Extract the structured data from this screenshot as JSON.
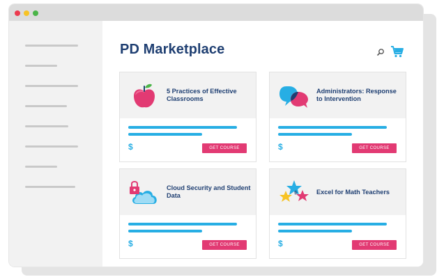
{
  "window": {
    "controls": [
      "close",
      "minimize",
      "maximize"
    ]
  },
  "sidebar": {
    "items": [
      {
        "placeholder": "line"
      },
      {
        "placeholder": "line"
      },
      {
        "placeholder": "line"
      },
      {
        "placeholder": "line"
      },
      {
        "placeholder": "line"
      },
      {
        "placeholder": "line"
      },
      {
        "placeholder": "line"
      },
      {
        "placeholder": "line"
      }
    ]
  },
  "header": {
    "title": "PD Marketplace",
    "search_icon": "search-icon",
    "cart_icon": "cart-icon"
  },
  "courses": [
    {
      "title": "5 Practices of Effective Classrooms",
      "icon": "apple-icon",
      "price": "$",
      "button": "GET COURSE"
    },
    {
      "title": "Administrators: Response to Intervention",
      "icon": "speech-bubbles-icon",
      "price": "$",
      "button": "GET COURSE"
    },
    {
      "title": "Cloud Security and Student Data",
      "icon": "cloud-lock-icon",
      "price": "$",
      "button": "GET COURSE"
    },
    {
      "title": "Excel for Math Teachers",
      "icon": "stars-icon",
      "price": "$",
      "button": "GET COURSE"
    }
  ],
  "colors": {
    "title": "#1f3f72",
    "accent_blue": "#27aee4",
    "button_pink": "#e23a73",
    "sidebar_bg": "#f2f2f2",
    "titlebar_bg": "#dcdcdc"
  }
}
